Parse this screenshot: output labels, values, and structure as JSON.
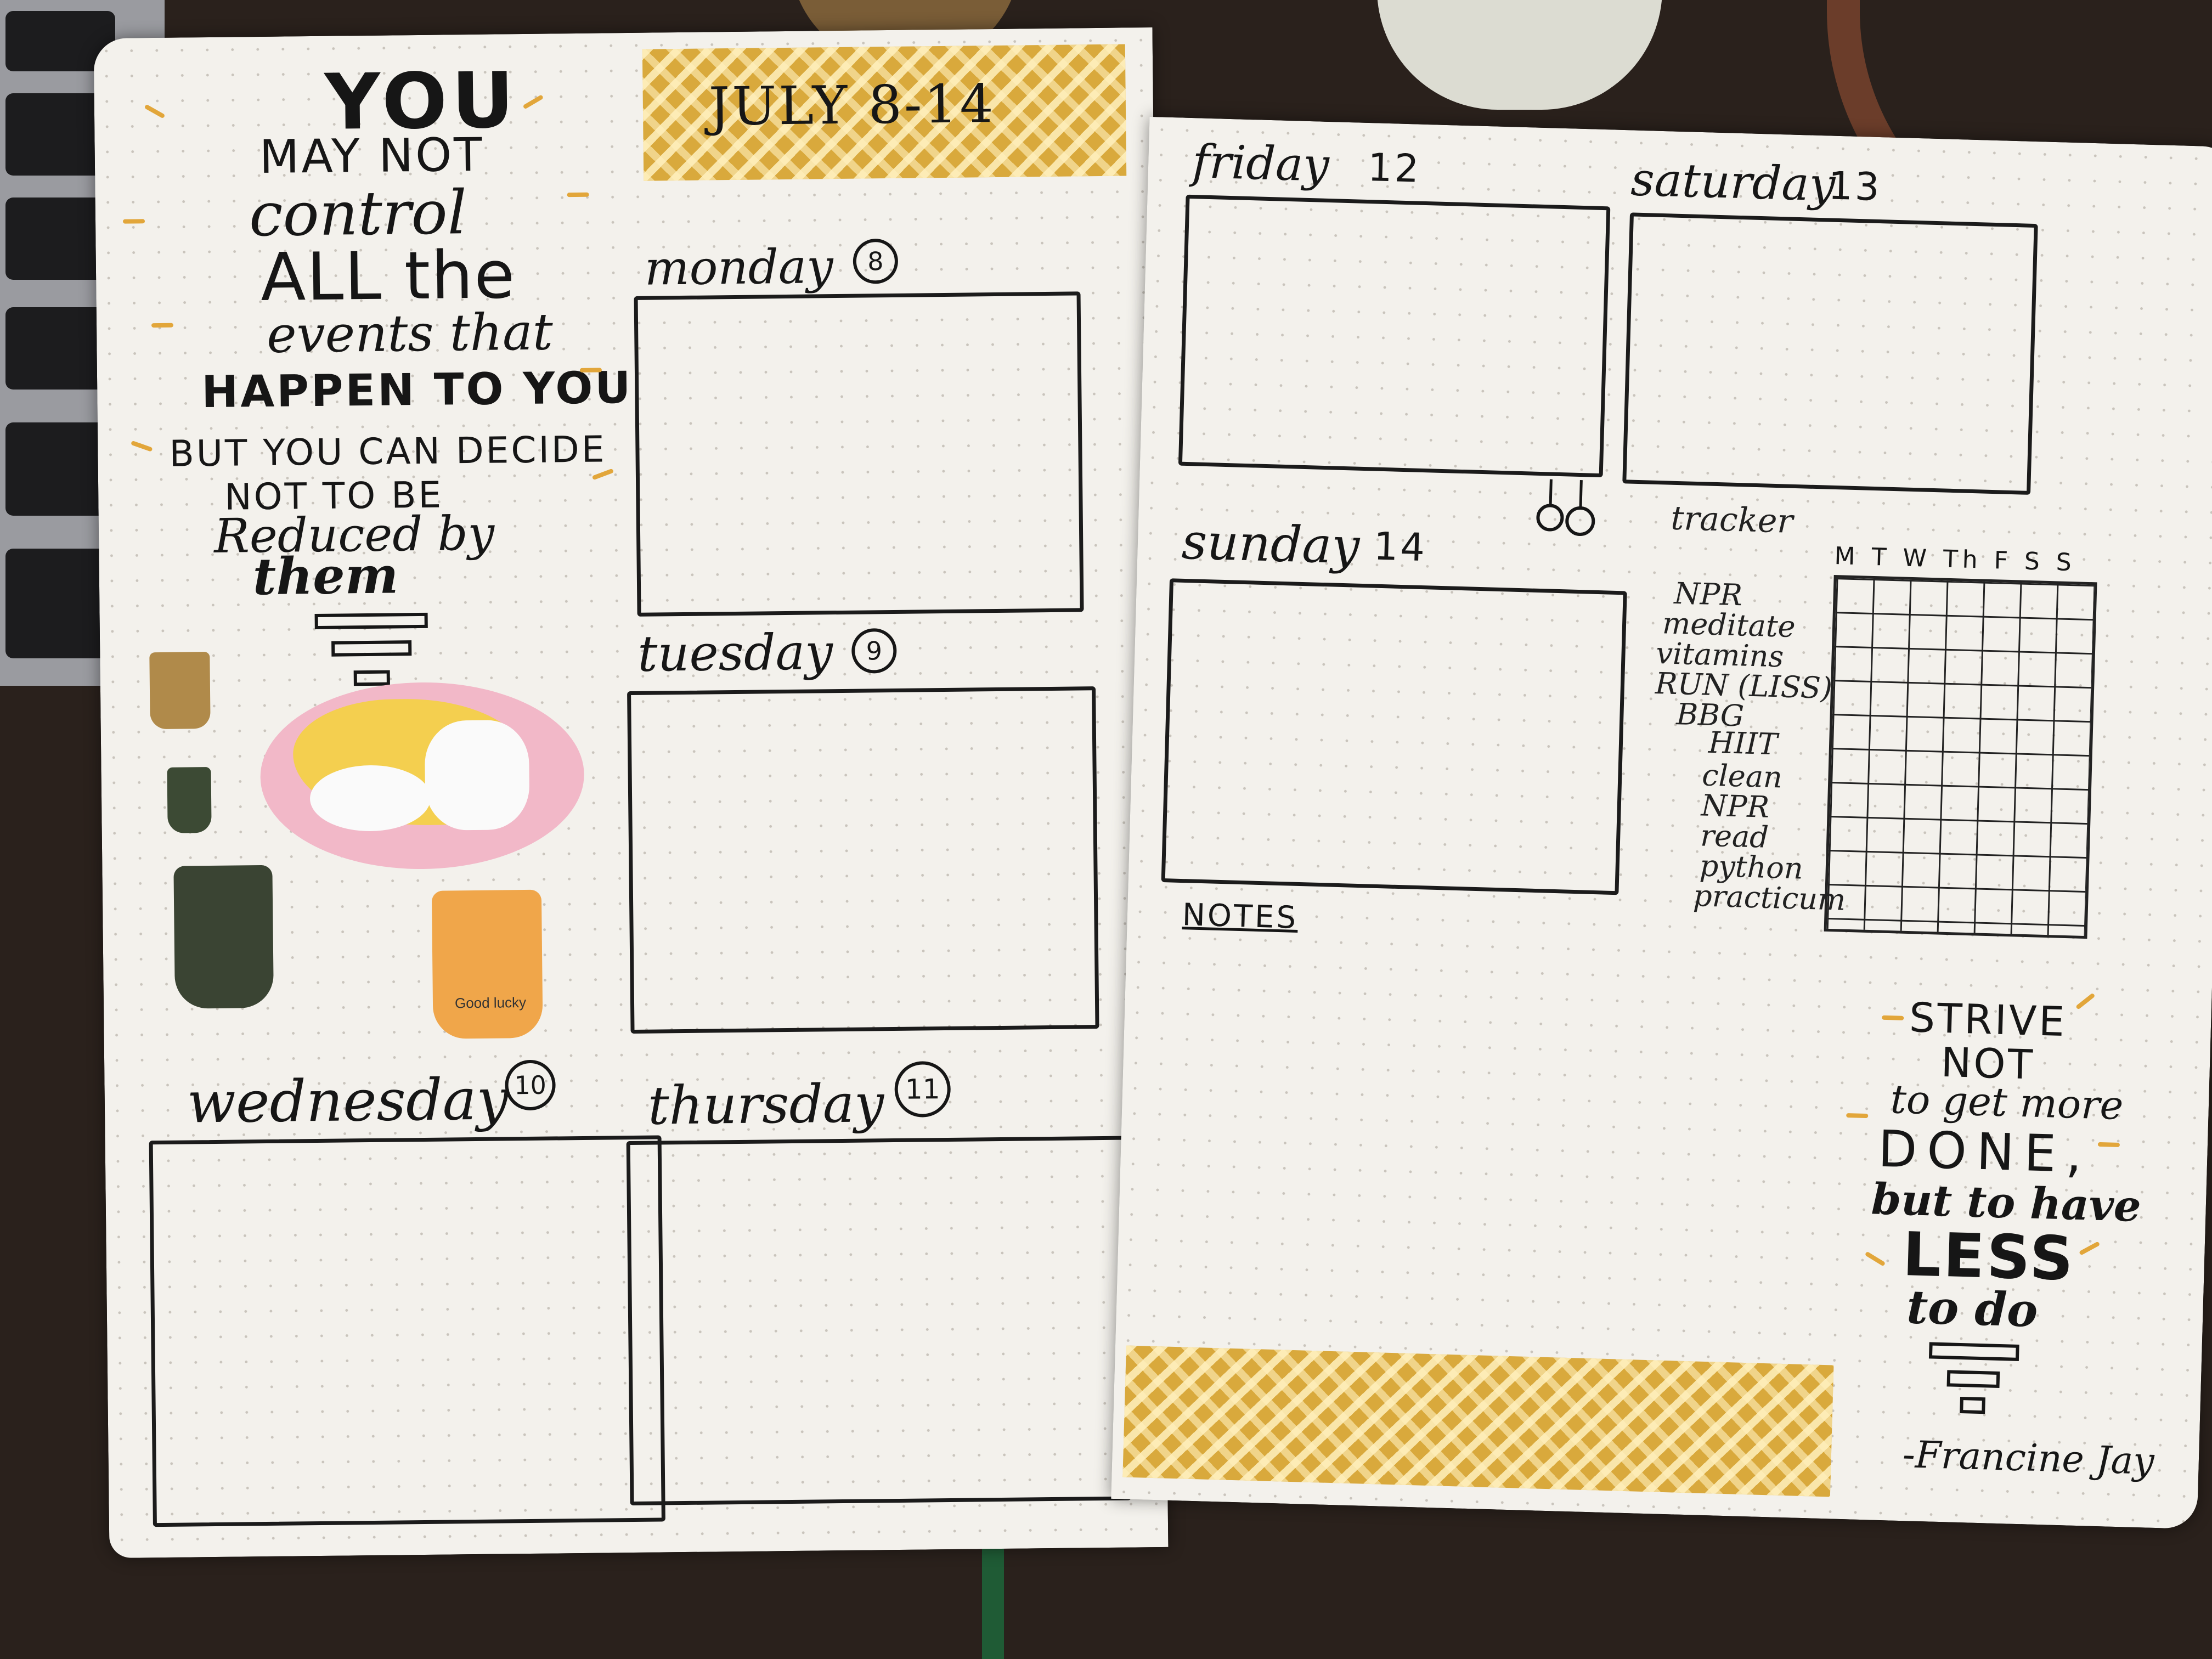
{
  "left_page": {
    "quote_lines": [
      "YOU",
      "MAY NOT",
      "control",
      "ALL the",
      "events that",
      "HAPPEN TO YOU",
      "BUT YOU CAN DECIDE",
      "NOT TO BE",
      "Reduced by",
      "them"
    ],
    "header_tape_text": "JULY 8-14",
    "days": [
      {
        "name": "monday",
        "num": "8"
      },
      {
        "name": "tuesday",
        "num": "9"
      },
      {
        "name": "wednesday",
        "num": "10"
      },
      {
        "name": "thursday",
        "num": "11"
      }
    ],
    "sticker_labels": [
      "Good lucky"
    ]
  },
  "right_page": {
    "days": [
      {
        "name": "friday",
        "num": "12"
      },
      {
        "name": "saturday",
        "num": "13"
      },
      {
        "name": "sunday",
        "num": "14"
      }
    ],
    "tracker": {
      "title": "tracker",
      "columns": "M T W Th F S S",
      "habits": [
        "NPR",
        "meditate",
        "vitamins",
        "RUN (LISS)",
        "BBG",
        "HIIT",
        "clean",
        "NPR",
        "read",
        "python",
        "practicum"
      ]
    },
    "notes_label": "NOTES",
    "quote_lines": [
      "STRIVE",
      "NOT",
      "to get more",
      "DONE,",
      "but to have",
      "LESS",
      "to do"
    ],
    "attribution": "-Francine Jay"
  },
  "colors": {
    "ink": "#161616",
    "tape": "#d9a93c",
    "accent_dash": "#e2a63a",
    "paper": "#f3f1ec"
  }
}
